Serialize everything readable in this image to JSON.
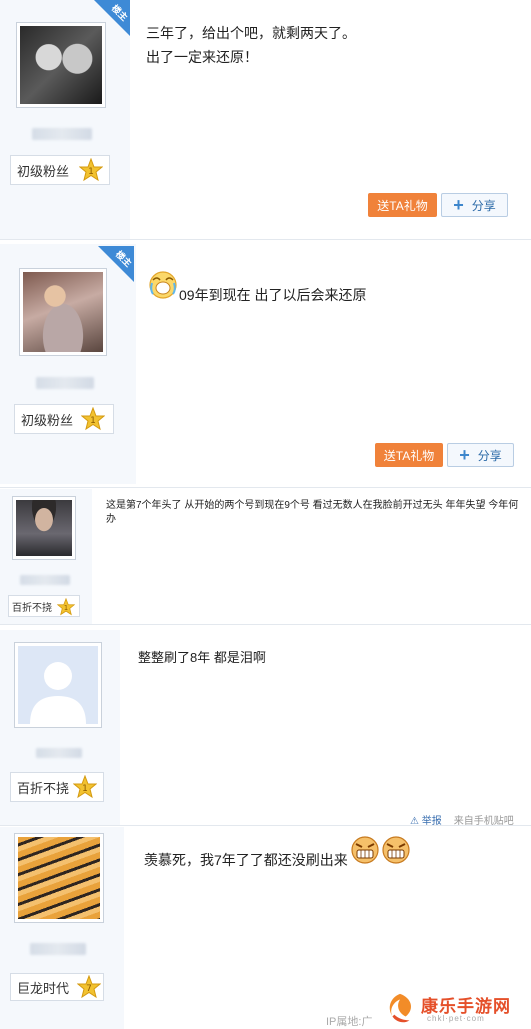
{
  "badge": {
    "text": "楼主"
  },
  "posts": [
    {
      "rank": "初级粉丝",
      "level": "1",
      "lines": [
        "三年了，给出个吧，就剩两天了。",
        "出了一定来还原！"
      ],
      "gift_label": "送TA礼物",
      "share_label": "分享"
    },
    {
      "rank": "初级粉丝",
      "level": "1",
      "text": "09年到现在 出了以后会来还原",
      "gift_label": "送TA礼物",
      "share_label": "分享"
    },
    {
      "rank": "百折不挠",
      "level": "1",
      "text": "这是第7个年头了 从开始的两个号到现在9个号 看过无数人在我脸前开过无头 年年失望 今年何办"
    },
    {
      "rank": "百折不挠",
      "level": "1",
      "text": "整整刷了8年 都是泪啊",
      "report_label": "举报",
      "from_label": "来自手机贴吧"
    },
    {
      "rank": "巨龙时代",
      "level": "7",
      "text": "羡慕死，我7年了了都还没刷出来",
      "ip_label": "IP属地:广"
    }
  ],
  "watermark": {
    "name": "康乐手游网",
    "domain": "chkl·pet·com"
  },
  "colors": {
    "gift": "#f0823a",
    "badge": "#3e8ad6",
    "star": "#f2c230",
    "link": "#3a6fb0"
  }
}
